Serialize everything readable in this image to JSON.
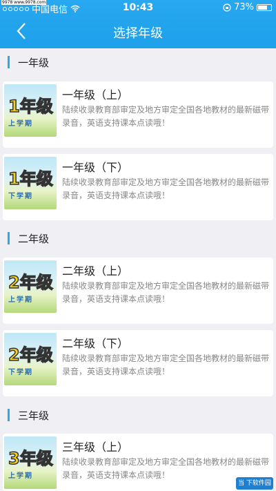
{
  "status_bar": {
    "watermark": "9978 www.9978.com",
    "carrier": "中国电信",
    "time": "10:43",
    "battery": "73%"
  },
  "nav": {
    "title": "选择年级"
  },
  "sections": [
    {
      "label": "一年级"
    },
    {
      "label": "二年级"
    },
    {
      "label": "三年级"
    }
  ],
  "cards": [
    {
      "title": "一年级（上）",
      "badge": "1年级",
      "term": "上学期",
      "desc": "陆续收录教育部审定及地方审定全国各地教材的最新磁带录音，英语支持课本点读哦！"
    },
    {
      "title": "一年级（下）",
      "badge": "1年级",
      "term": "下学期",
      "desc": "陆续收录教育部审定及地方审定全国各地教材的最新磁带录音，英语支持课本点读哦！"
    },
    {
      "title": "二年级（上）",
      "badge": "2年级",
      "term": "上学期",
      "desc": "陆续收录教育部审定及地方审定全国各地教材的最新磁带录音，英语支持课本点读哦！"
    },
    {
      "title": "二年级（下）",
      "badge": "2年级",
      "term": "下学期",
      "desc": "陆续收录教育部审定及地方审定全国各地教材的最新磁带录音，英语支持课本点读哦！"
    },
    {
      "title": "三年级（上）",
      "badge": "3年级",
      "term": "上学期",
      "desc": "陆续收录教育部审定及地方审定全国各地教材的最新磁带录音，英语支持课本点读哦！"
    }
  ],
  "corner_logo": "当 下软件园",
  "colors": {
    "header": "#1ea0ea",
    "accent": "#2aa6f2",
    "background": "#efeff4"
  }
}
